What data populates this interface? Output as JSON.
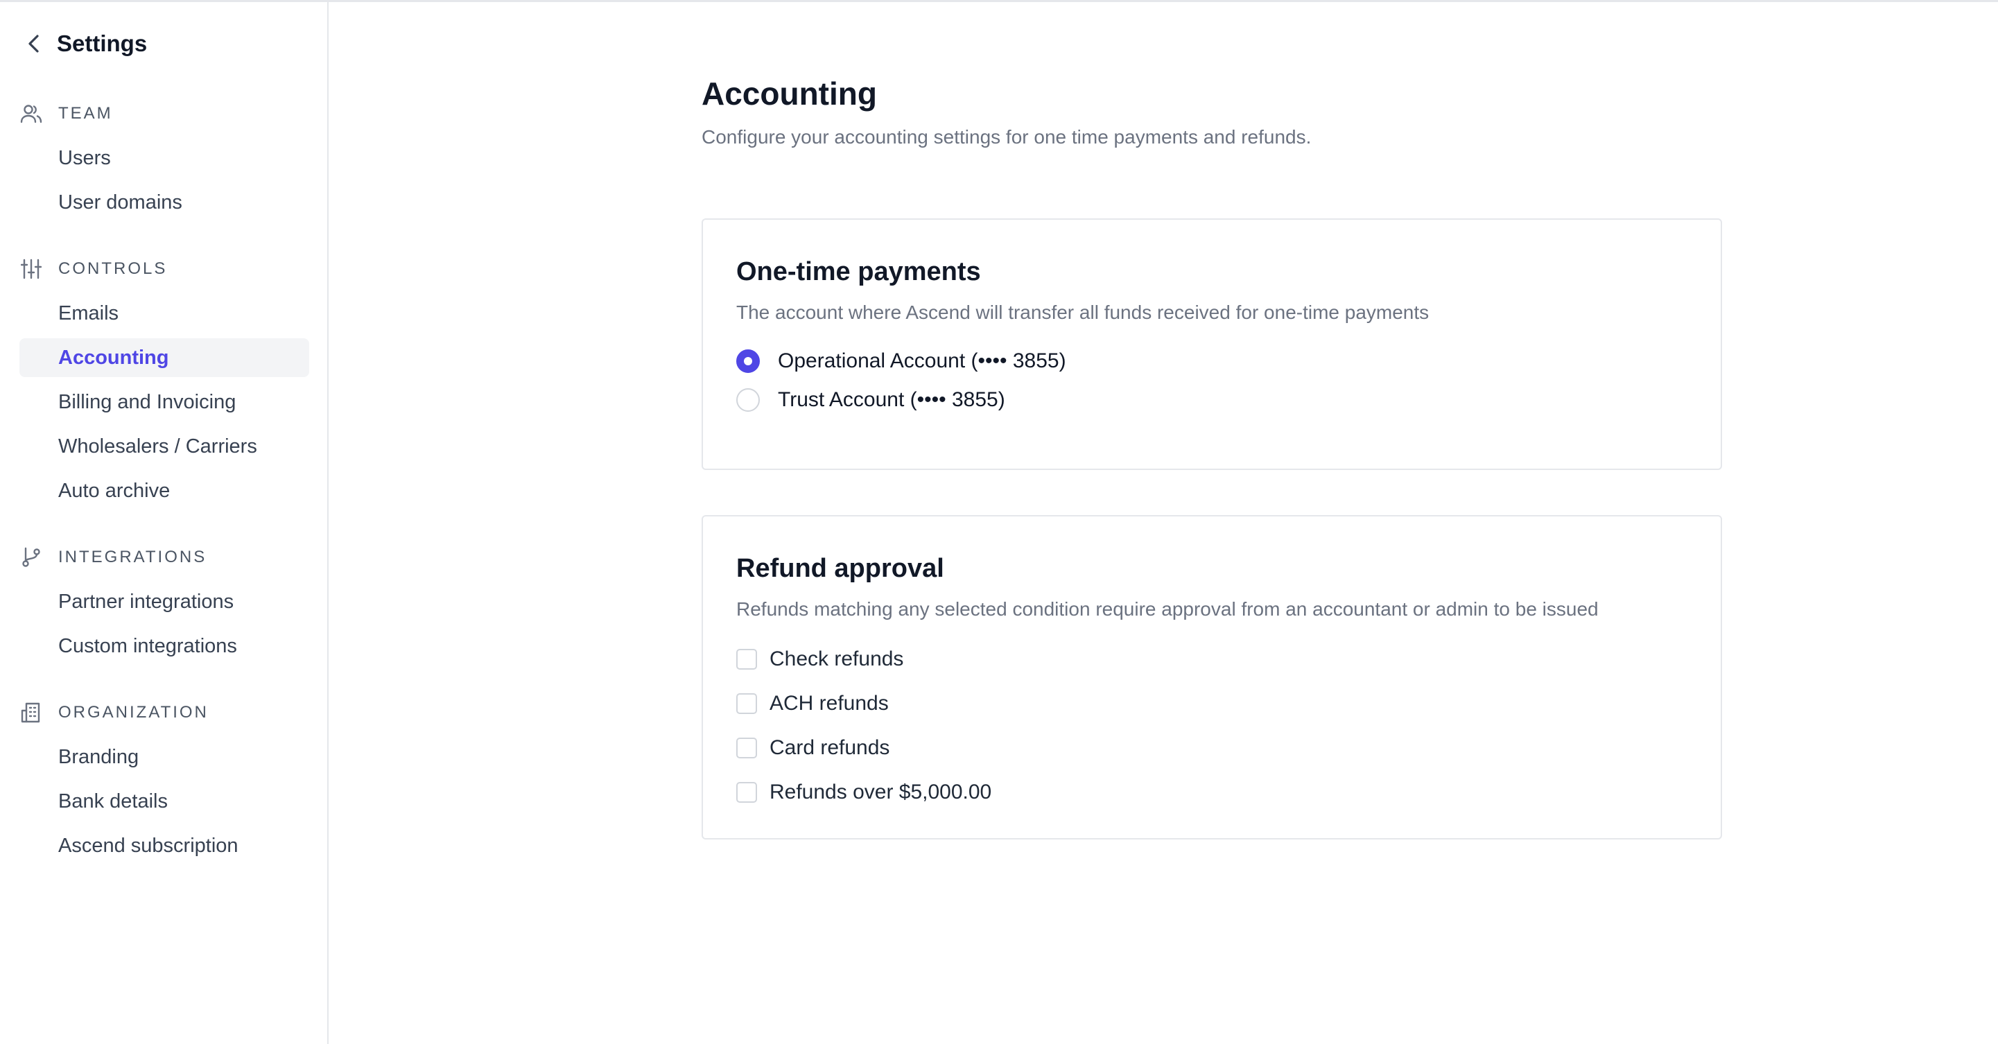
{
  "sidebar": {
    "title": "Settings",
    "sections": [
      {
        "label": "TEAM",
        "icon": "users-icon",
        "items": [
          {
            "label": "Users"
          },
          {
            "label": "User domains"
          }
        ]
      },
      {
        "label": "CONTROLS",
        "icon": "sliders-icon",
        "items": [
          {
            "label": "Emails"
          },
          {
            "label": "Accounting",
            "active": true
          },
          {
            "label": "Billing and Invoicing"
          },
          {
            "label": "Wholesalers / Carriers"
          },
          {
            "label": "Auto archive"
          }
        ]
      },
      {
        "label": "INTEGRATIONS",
        "icon": "git-branch-icon",
        "items": [
          {
            "label": "Partner integrations"
          },
          {
            "label": "Custom integrations"
          }
        ]
      },
      {
        "label": "ORGANIZATION",
        "icon": "building-icon",
        "items": [
          {
            "label": "Branding"
          },
          {
            "label": "Bank details"
          },
          {
            "label": "Ascend subscription"
          }
        ]
      }
    ]
  },
  "main": {
    "title": "Accounting",
    "subtitle": "Configure your accounting settings for one time payments and refunds.",
    "one_time": {
      "title": "One-time payments",
      "subtitle": "The account where Ascend will transfer all funds received for one-time payments",
      "options": [
        {
          "label": "Operational Account (•••• 3855)",
          "selected": true
        },
        {
          "label": "Trust Account (•••• 3855)",
          "selected": false
        }
      ]
    },
    "refund": {
      "title": "Refund approval",
      "subtitle": "Refunds matching any selected condition require approval from an accountant or admin to be issued",
      "conditions": [
        {
          "label": "Check refunds",
          "checked": false
        },
        {
          "label": "ACH refunds",
          "checked": false
        },
        {
          "label": "Card refunds",
          "checked": false
        },
        {
          "label": "Refunds over $5,000.00",
          "checked": false
        }
      ]
    }
  },
  "colors": {
    "accent": "#4f46e5",
    "border": "#e5e7eb",
    "muted_text": "#6b7280"
  }
}
